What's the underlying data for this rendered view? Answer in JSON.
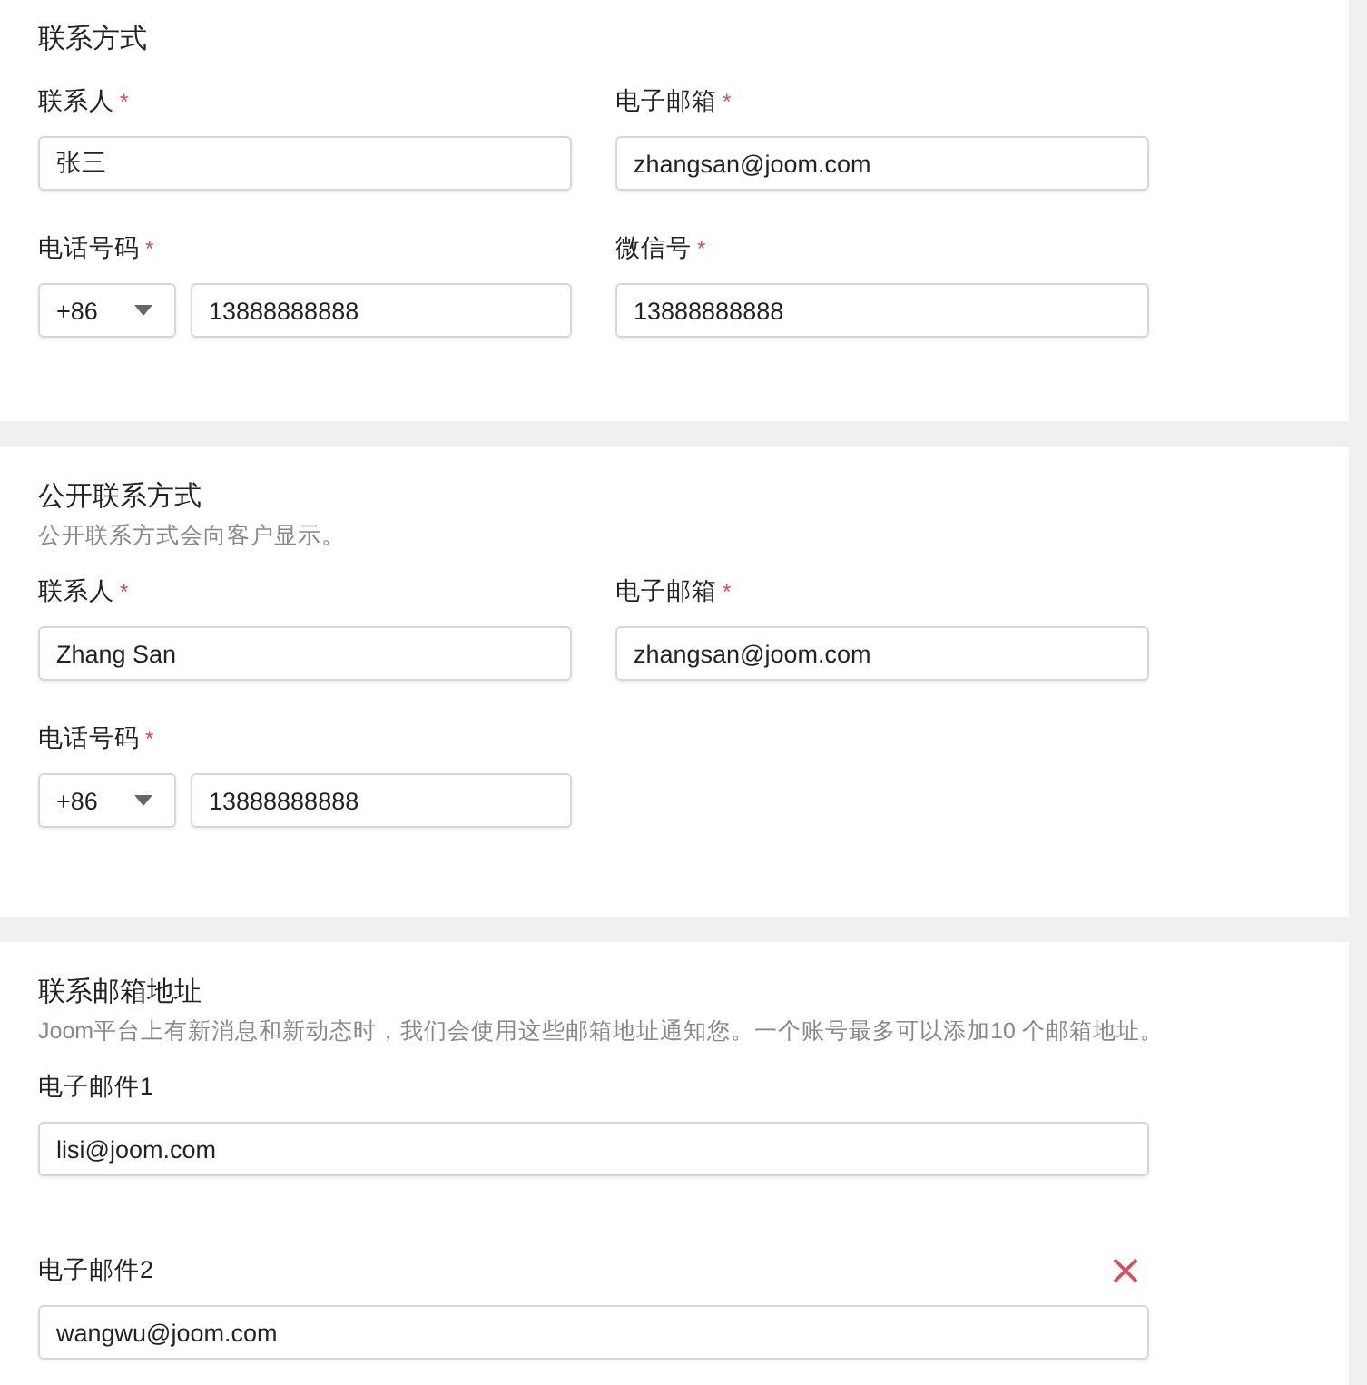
{
  "sections": [
    {
      "title": "联系方式",
      "fields": [
        {
          "kind": "text",
          "label": "联系人",
          "required_mark": "*",
          "value": "张三"
        },
        {
          "kind": "text",
          "label": "电子邮箱",
          "required_mark": "*",
          "value": "zhangsan@joom.com"
        },
        {
          "kind": "phone",
          "label": "电话号码",
          "required_mark": "*",
          "code": "+86",
          "value": "13888888888"
        },
        {
          "kind": "text",
          "label": "微信号",
          "required_mark": "*",
          "value": "13888888888"
        }
      ]
    },
    {
      "title": "公开联系方式",
      "description": "公开联系方式会向客户显示。",
      "fields": [
        {
          "kind": "text",
          "label": "联系人",
          "required_mark": "*",
          "value": "Zhang San"
        },
        {
          "kind": "text",
          "label": "电子邮箱",
          "required_mark": "*",
          "value": "zhangsan@joom.com"
        },
        {
          "kind": "phone",
          "label": "电话号码",
          "required_mark": "*",
          "code": "+86",
          "value": "13888888888"
        }
      ]
    },
    {
      "title": "联系邮箱地址",
      "description": "Joom平台上有新消息和新动态时，我们会使用这些邮箱地址通知您。一个账号最多可以添加10 个邮箱地址。",
      "fields": [
        {
          "kind": "wide",
          "label": "电子邮件1",
          "value": "lisi@joom.com"
        },
        {
          "kind": "wide",
          "label": "电子邮件2",
          "removable": true,
          "value": "wangwu@joom.com"
        }
      ]
    }
  ]
}
